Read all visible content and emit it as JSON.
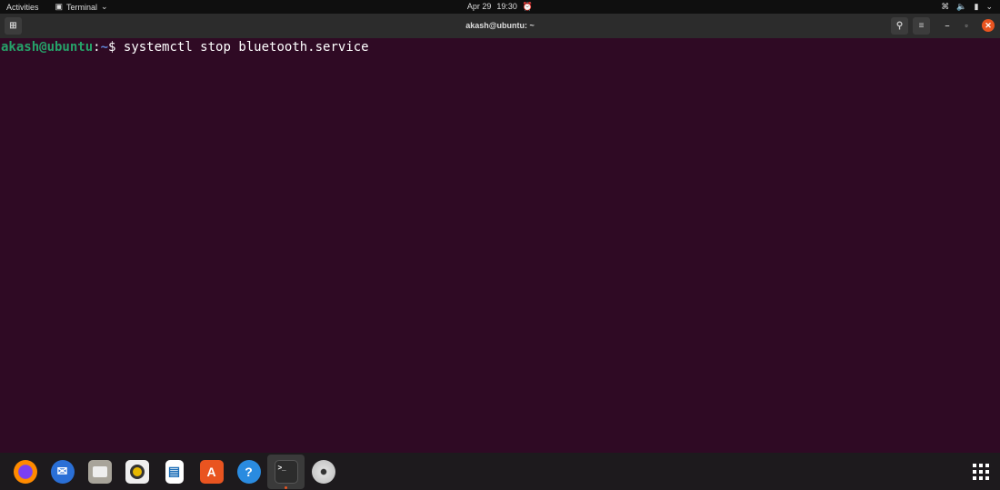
{
  "topbar": {
    "activities": "Activities",
    "app_menu": "Terminal",
    "date": "Apr 29",
    "time": "19:30"
  },
  "window": {
    "title": "akash@ubuntu: ~"
  },
  "terminal": {
    "user_host": "akash@ubuntu",
    "colon": ":",
    "path": "~",
    "prompt": "$ ",
    "command": "systemctl stop bluetooth.service"
  },
  "dock": {
    "apps": [
      "Firefox",
      "Thunderbird",
      "Files",
      "Rhythmbox",
      "LibreOffice Writer",
      "Ubuntu Software",
      "Help",
      "Terminal",
      "Disc"
    ]
  },
  "colors": {
    "terminal_bg": "#2f0a24",
    "prompt_user": "#26a269",
    "prompt_path": "#5f87d7",
    "accent": "#e95420"
  }
}
